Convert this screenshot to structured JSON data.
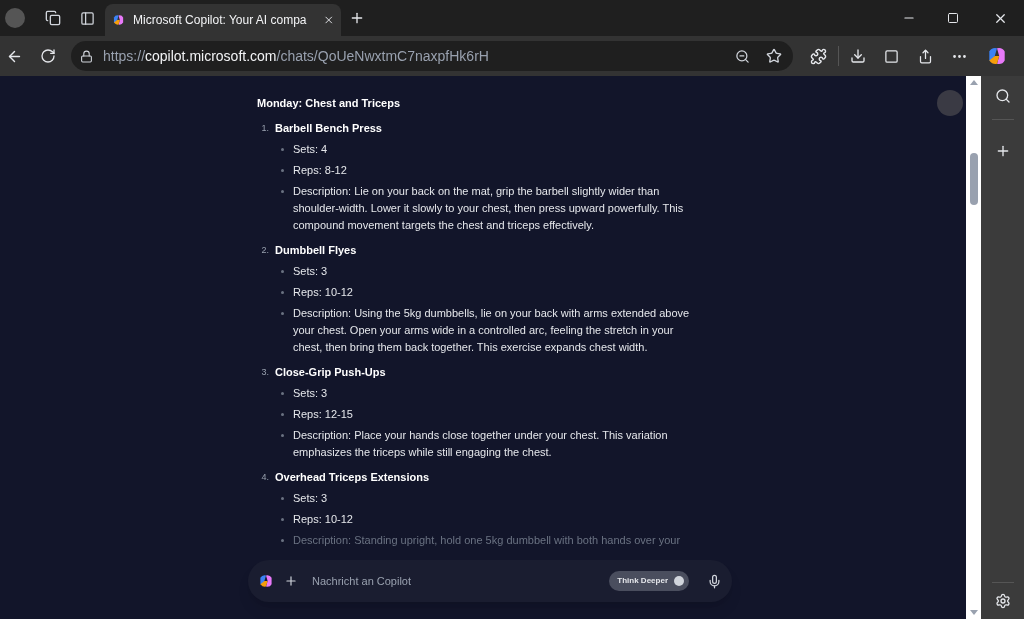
{
  "browser": {
    "tab": {
      "title": "Microsoft Copilot: Your AI compa",
      "selected": true
    },
    "address": {
      "scheme": "https://",
      "host": "copilot.microsoft.com",
      "path": "/chats/QoUeNwxtmC7naxpfHk6rH"
    }
  },
  "chat": {
    "heading": "Monday: Chest and Triceps",
    "exercises": [
      {
        "number": "1.",
        "name": "Barbell Bench Press",
        "details": [
          "Sets: 4",
          "Reps: 8-12",
          "Description: Lie on your back on the mat, grip the barbell slightly wider than shoulder-width. Lower it slowly to your chest, then press upward powerfully. This compound movement targets the chest and triceps effectively."
        ]
      },
      {
        "number": "2.",
        "name": "Dumbbell Flyes",
        "details": [
          "Sets: 3",
          "Reps: 10-12",
          "Description: Using the 5kg dumbbells, lie on your back with arms extended above your chest. Open your arms wide in a controlled arc, feeling the stretch in your chest, then bring them back together. This exercise expands chest width."
        ]
      },
      {
        "number": "3.",
        "name": "Close-Grip Push-Ups",
        "details": [
          "Sets: 3",
          "Reps: 12-15",
          "Description: Place your hands close together under your chest. This variation emphasizes the triceps while still engaging the chest."
        ]
      },
      {
        "number": "4.",
        "name": "Overhead Triceps Extensions",
        "details": [
          "Sets: 3",
          "Reps: 10-12",
          "Description: Standing upright, hold one 5kg dumbbell with both hands over your"
        ]
      }
    ]
  },
  "composer": {
    "placeholder": "Nachricht an Copilot",
    "think_deeper": {
      "label": "Think Deeper",
      "on": false
    }
  }
}
